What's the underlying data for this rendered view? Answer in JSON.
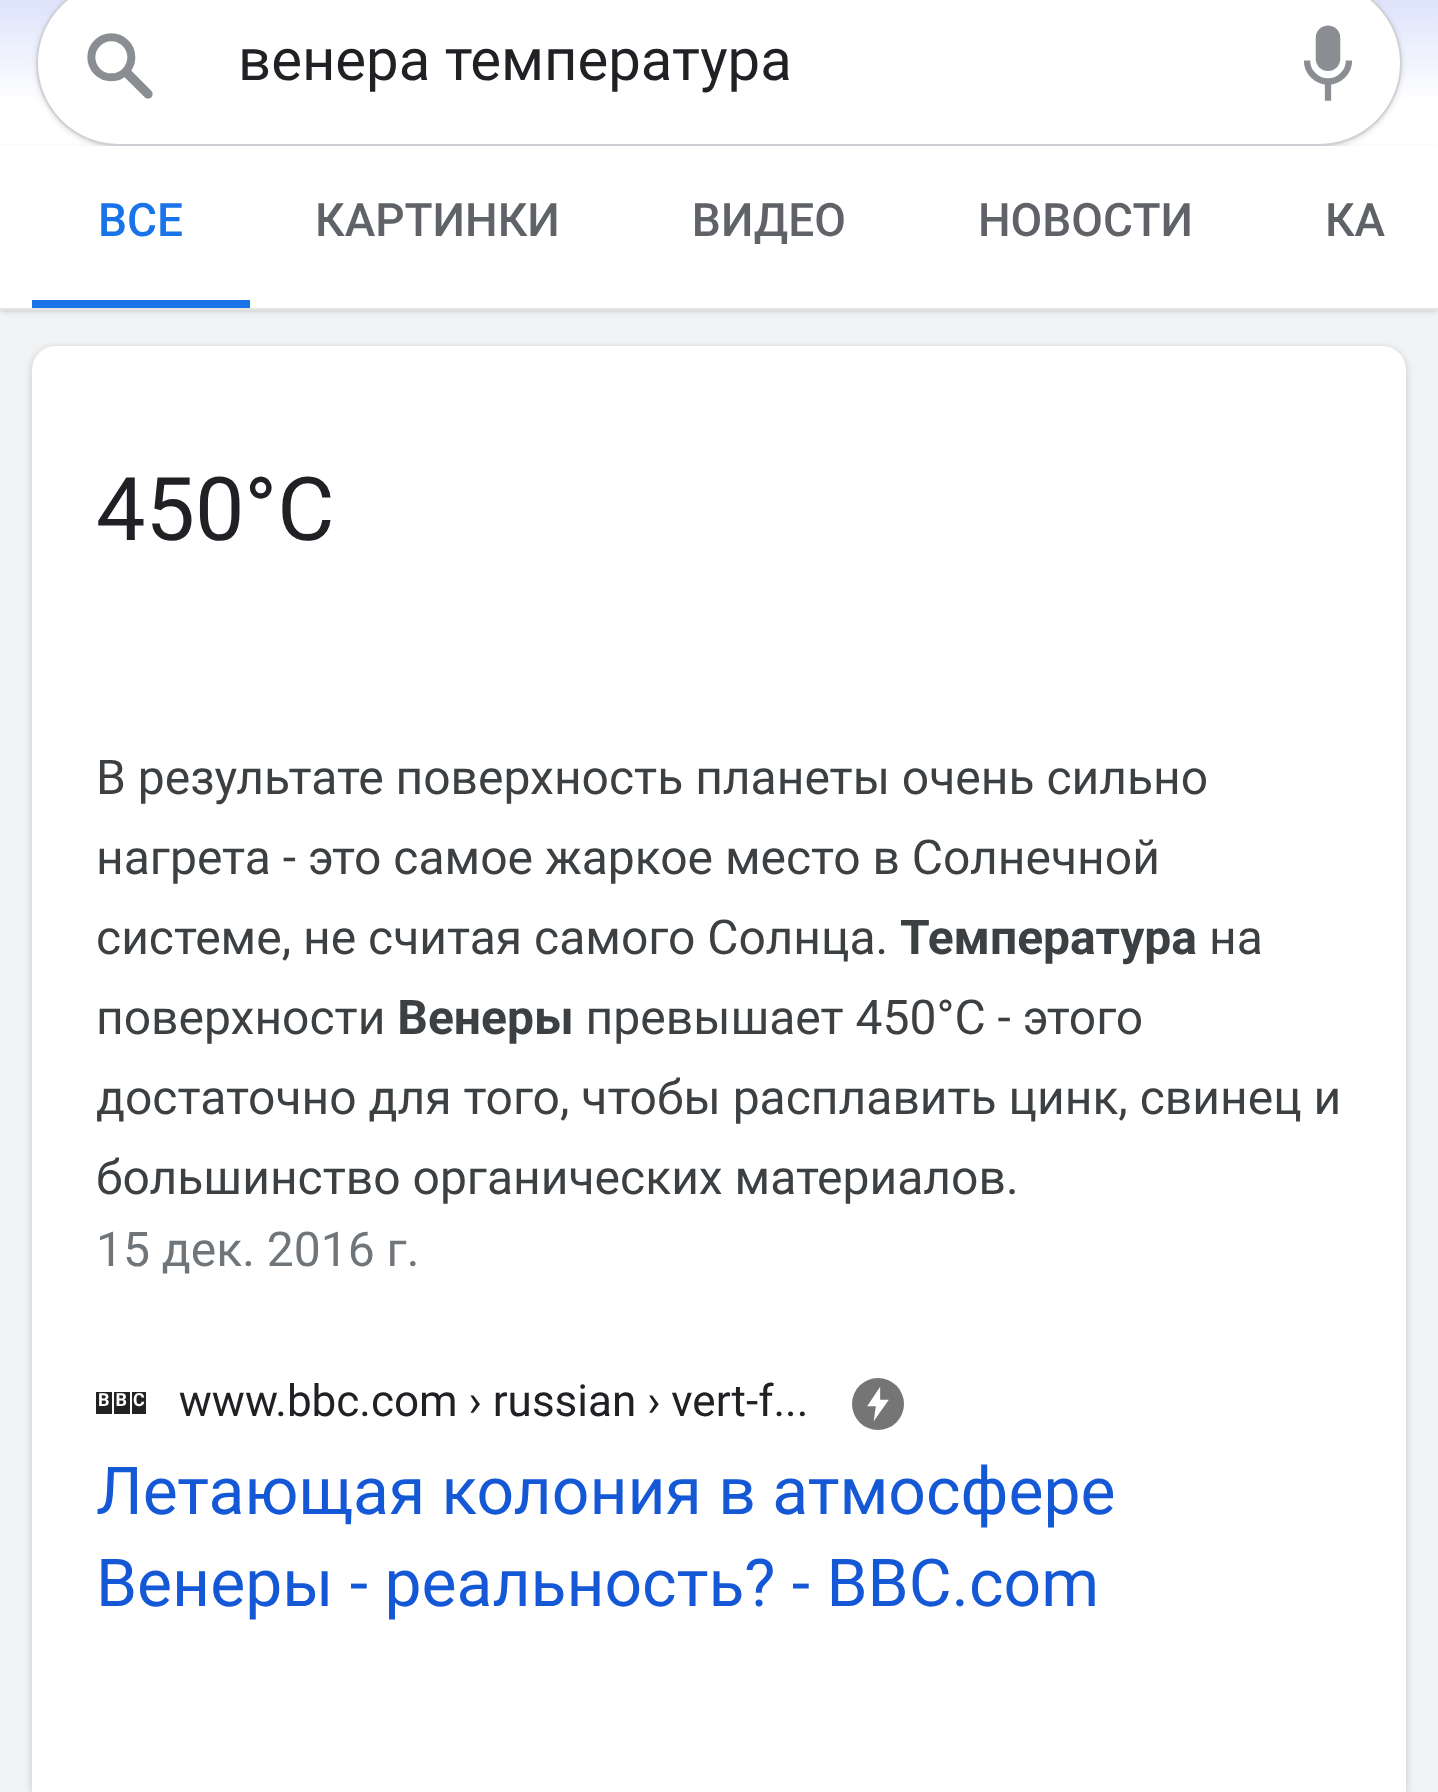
{
  "search": {
    "value": "венера температура"
  },
  "tabs": [
    {
      "label": "ВСЕ",
      "selected": true
    },
    {
      "label": "КАРТИНКИ",
      "selected": false
    },
    {
      "label": "ВИДЕО",
      "selected": false
    },
    {
      "label": "НОВОСТИ",
      "selected": false
    },
    {
      "label": "КА",
      "selected": false
    }
  ],
  "answer": {
    "value": "450°C",
    "snippet": "В результате поверхность планеты очень сильно нагрета - это самое жаркое место в Солнечной системе, не считая самого Солнца. **Температура** на поверхности **Венеры** превышает 450°C - этого достаточно для того, чтобы расплавить цинк, свинец и большинство органических материалов.",
    "date": "15 дек. 2016 г.",
    "source": {
      "logo_letters": [
        "B",
        "B",
        "C"
      ],
      "url": "www.bbc.com › russian › vert-f...",
      "title": "Летающая колония в атмосфере Венеры - реальность? - BBC.com"
    }
  }
}
